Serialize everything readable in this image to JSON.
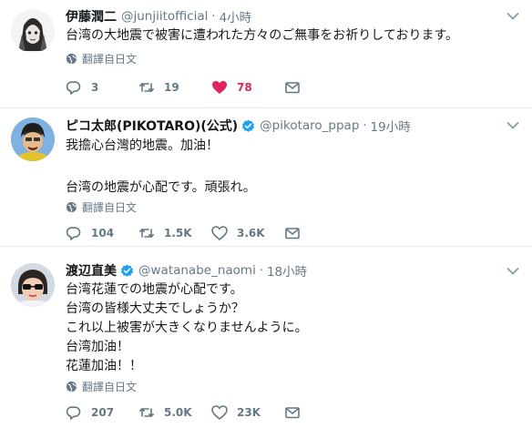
{
  "tweets": [
    {
      "name": "伊藤潤二",
      "verified": false,
      "handle": "@junjiitofficial",
      "time": "4小時",
      "lines": [
        "台湾の大地震で被害に遭われた方々のご無事をお祈りしております。"
      ],
      "translate": "翻譯自日文",
      "replies": "3",
      "retweets": "19",
      "likes": "78",
      "liked": true
    },
    {
      "name": "ピコ太郎(PIKOTARO)(公式)",
      "verified": true,
      "handle": "@pikotaro_ppap",
      "time": "19小時",
      "lines": [
        "我擔心台灣的地震。加油！",
        "",
        "台湾の地震が心配です。頑張れ。"
      ],
      "translate": "翻譯自日文",
      "replies": "104",
      "retweets": "1.5K",
      "likes": "3.6K",
      "liked": false
    },
    {
      "name": "渡辺直美",
      "verified": true,
      "handle": "@watanabe_naomi",
      "time": "18小時",
      "lines": [
        "台湾花蓮での地震が心配です。",
        "台湾の皆様大丈夫でしょうか？",
        "これ以上被害が大きくなりませんように。",
        "台湾加油！",
        "花蓮加油！！"
      ],
      "translate": "翻譯自日文",
      "replies": "207",
      "retweets": "5.0K",
      "likes": "23K",
      "liked": false
    }
  ],
  "colors": {
    "accent": "#1da1f2",
    "like": "#e0245e",
    "muted": "#657786",
    "divider": "#e6ecf0"
  },
  "icons": [
    "reply-icon",
    "retweet-icon",
    "heart-icon",
    "mail-icon",
    "globe-icon",
    "verified-badge-icon",
    "chevron-down-icon"
  ]
}
